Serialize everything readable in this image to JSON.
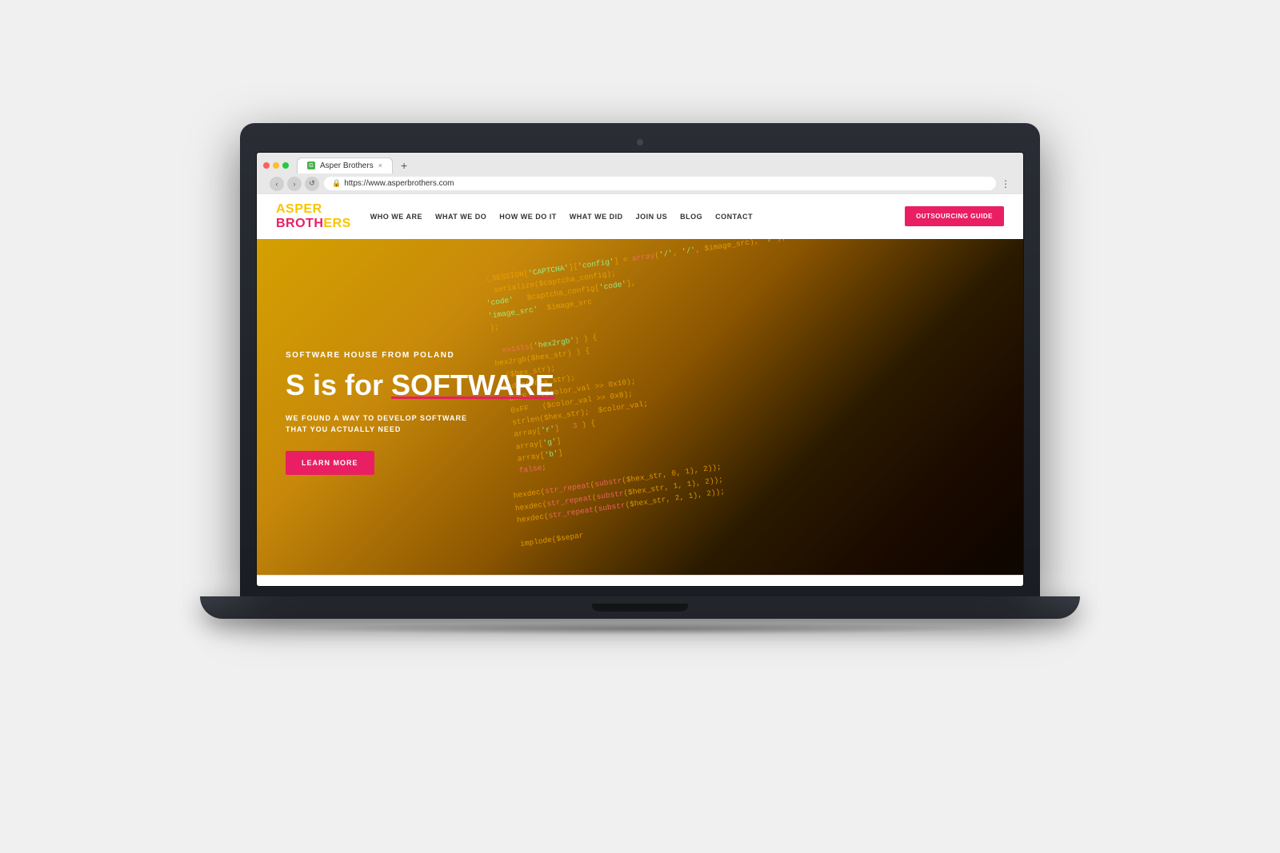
{
  "browser": {
    "tab_title": "Asper Brothers",
    "tab_close": "×",
    "tab_new": "+",
    "url": "https://www.asperbrothers.com",
    "nav_back": "‹",
    "nav_forward": "›",
    "nav_reload": "↺",
    "menu_icon": "⋮"
  },
  "logo": {
    "asper": "ASPER",
    "brothers_prefix": "BROTH",
    "brothers_highlight": "ERS",
    "tagline": ""
  },
  "nav": {
    "links": [
      {
        "label": "WHO WE ARE",
        "id": "who-we-are"
      },
      {
        "label": "WHAT WE DO",
        "id": "what-we-do"
      },
      {
        "label": "HOW WE DO IT",
        "id": "how-we-do-it"
      },
      {
        "label": "WHAT WE DID",
        "id": "what-we-did"
      },
      {
        "label": "JOIN US",
        "id": "join-us"
      },
      {
        "label": "BLOG",
        "id": "blog"
      },
      {
        "label": "CONTACT",
        "id": "contact"
      }
    ],
    "cta_label": "OUTSOURCING GUIDE"
  },
  "hero": {
    "subtitle": "SOFTWARE HOUSE FROM POLAND",
    "title_prefix": "S is for ",
    "title_highlight": "SOFTWARE",
    "description_line1": "WE FOUND A WAY TO DEVELOP SOFTWARE",
    "description_line2": "THAT YOU ACTUALLY NEED",
    "cta_label": "LEARN MORE"
  },
  "code": {
    "content": "$_SESSION['CAPTCHA']['config'] = array('/', '/', $image_src), '/');\n  serialize($captcha_config);\n'code'   $captcha_config['code'],\n'image_src'  $image_src\n);\n\n  exists('hex2rgb') ) {\nhex2rgb($hex_str) ) {\n  ($hex_str);\nhexdec($hex_str);\n  0xFF\n  0xFF\n  strlen($hex_str);\n  array['r']\n  array['g']\n  array['b']\n  false;\n\nhexdec(str_repeat(substr($hex_str, 0, 1), 2));\nhexdec(str_repeat(substr($hex_str, 1, 1), 2));\nhexdec(str_repeat(substr($hex_str, 2, 1), 2));\n\nimplode($separ"
  },
  "colors": {
    "brand_yellow": "#f7c500",
    "brand_pink": "#e91e63",
    "nav_text": "#333333",
    "hero_bg_start": "#d4a000",
    "hero_bg_end": "#0d0500",
    "white": "#ffffff",
    "code_color": "#f0a500"
  }
}
